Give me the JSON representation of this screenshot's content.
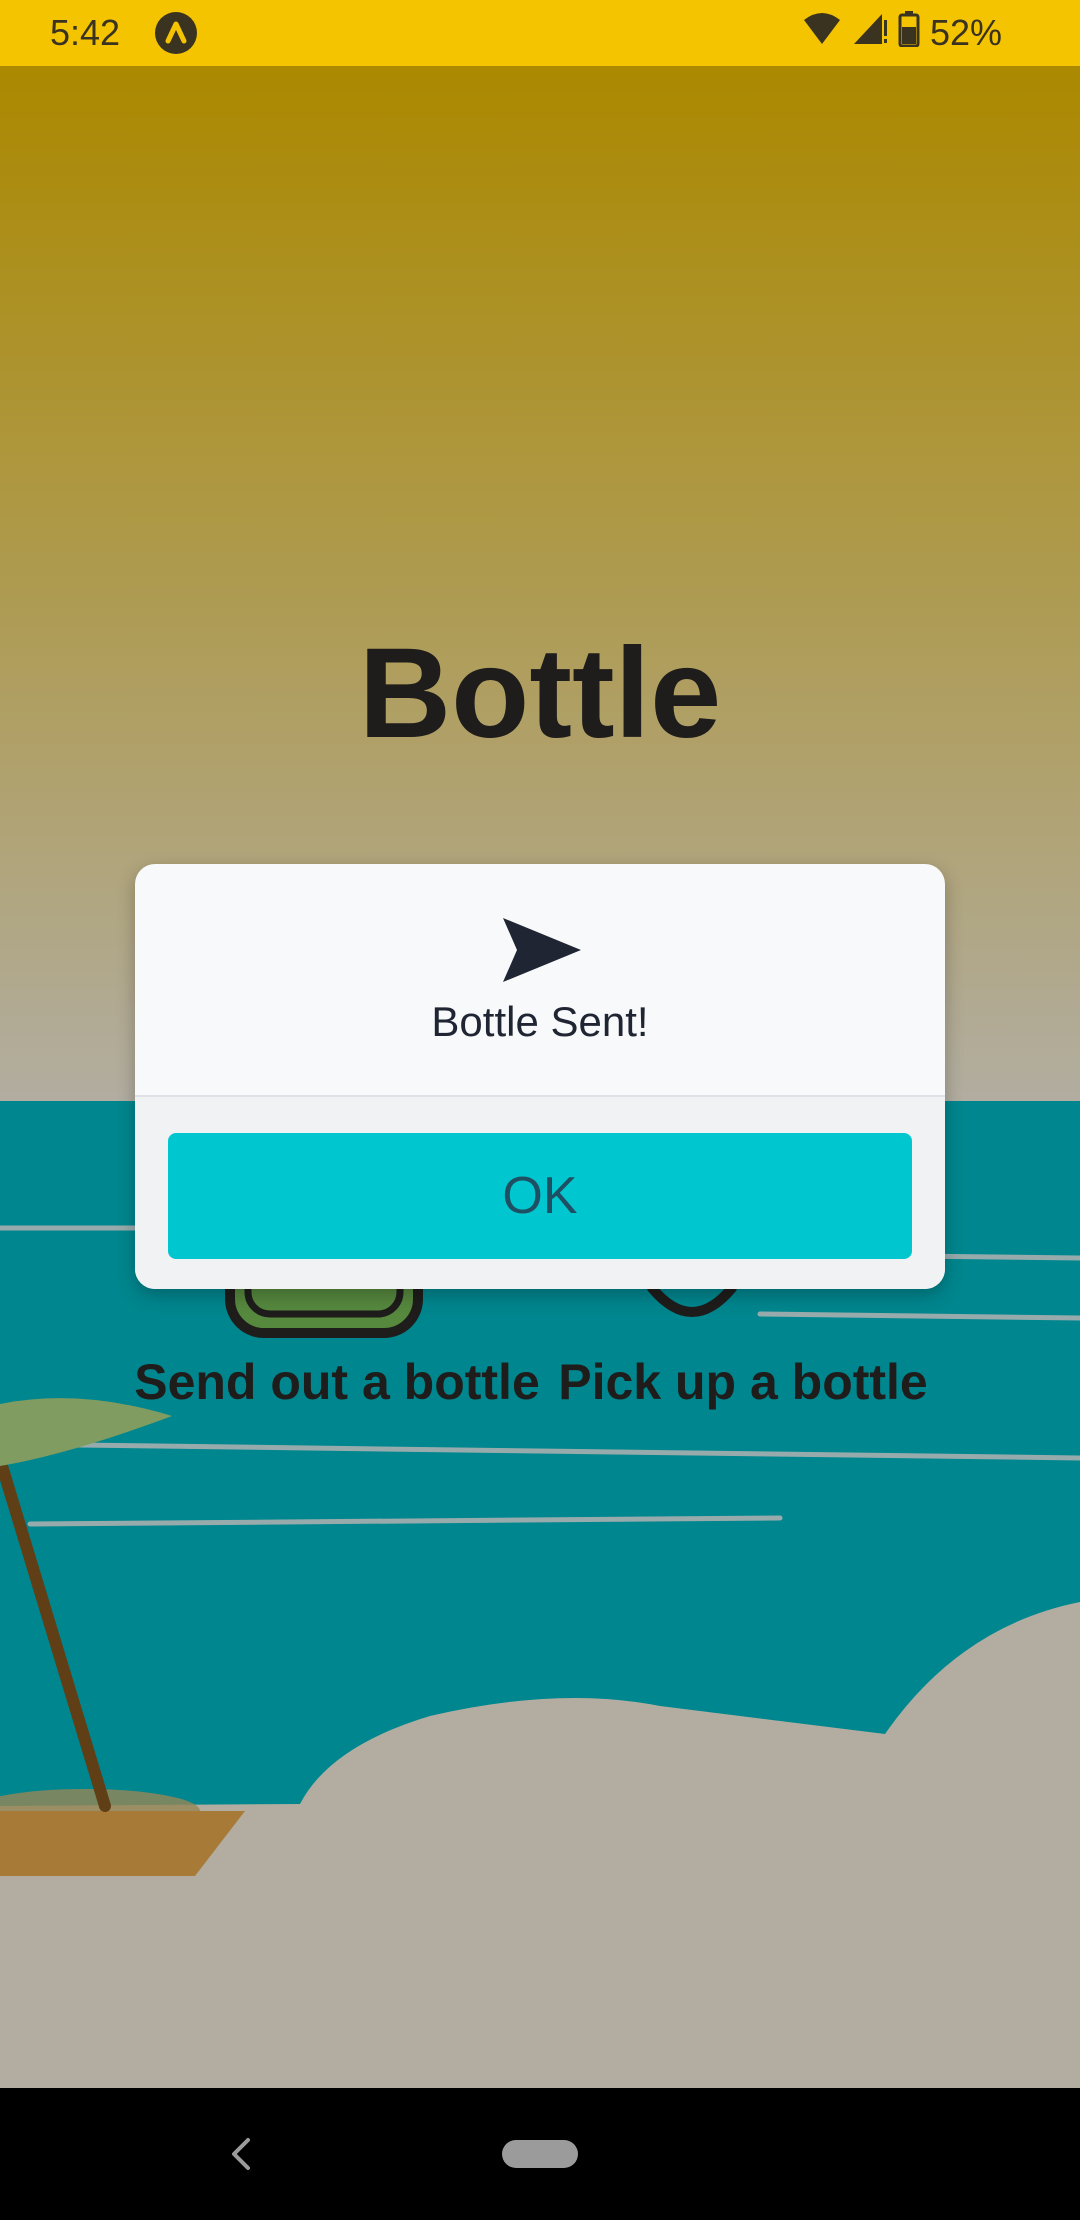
{
  "status_bar": {
    "time": "5:42",
    "battery": "52%",
    "icons": [
      "app-badge-icon",
      "wifi-icon",
      "signal-icon",
      "battery-icon"
    ]
  },
  "app": {
    "title": "Bottle",
    "options": {
      "send": "Send out a bottle",
      "pick": "Pick up a bottle"
    }
  },
  "dialog": {
    "icon": "send-icon",
    "message": "Bottle Sent!",
    "ok_label": "OK"
  },
  "nav_bar": {
    "icons": [
      "back-icon",
      "home-pill-icon"
    ]
  },
  "colors": {
    "status_bar": "#f5c400",
    "sky_top": "#f5c400",
    "sea": "#00c0cc",
    "sand": "#fff8e6",
    "dialog_button": "#00c6cf",
    "title_text": "#2b2a28"
  }
}
